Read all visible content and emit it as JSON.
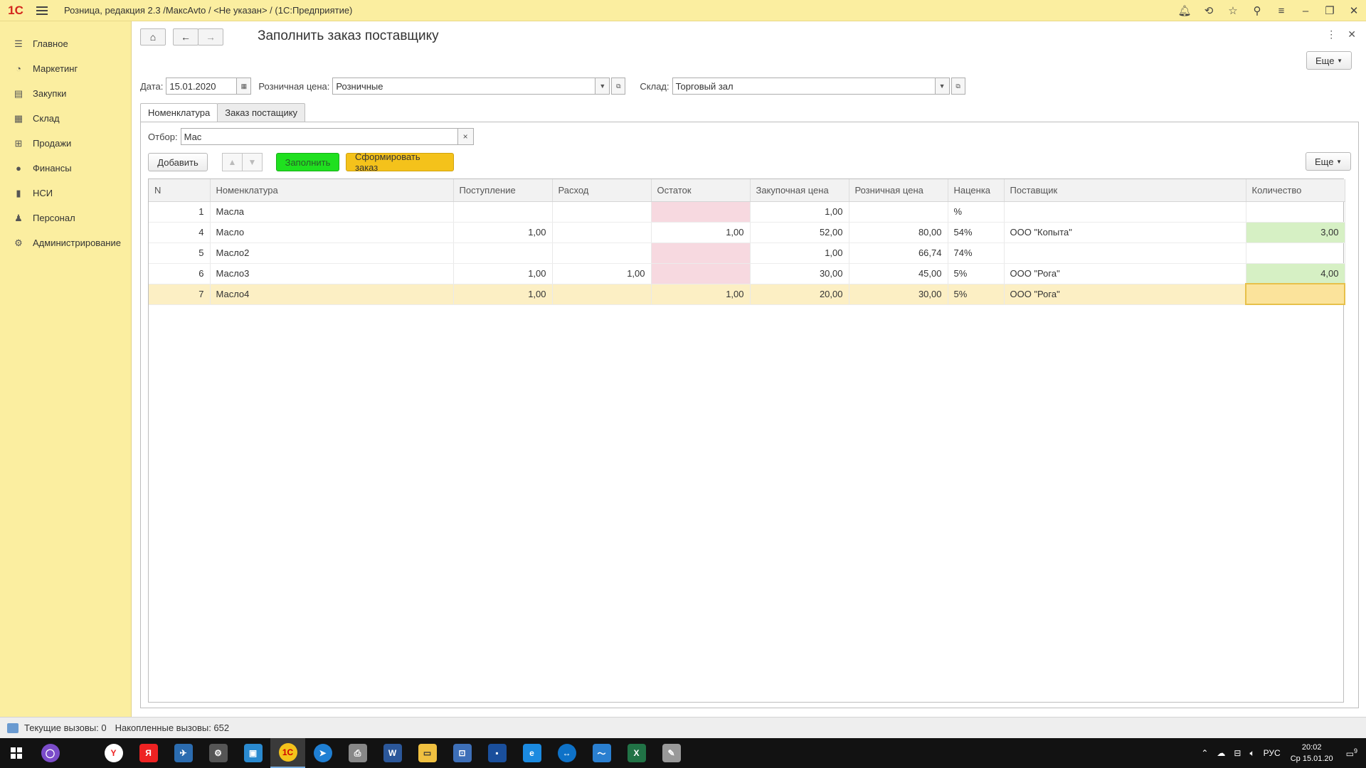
{
  "titlebar": {
    "logo": "1С",
    "title": "Розница, редакция 2.3 /МаксАvto / <Не указан> /  (1С:Предприятие)"
  },
  "sidebar": {
    "items": [
      {
        "label": "Главное",
        "icon": "menu-icon"
      },
      {
        "label": "Маркетинг",
        "icon": "pie-chart-icon"
      },
      {
        "label": "Закупки",
        "icon": "purchases-icon"
      },
      {
        "label": "Склад",
        "icon": "warehouse-icon"
      },
      {
        "label": "Продажи",
        "icon": "basket-icon"
      },
      {
        "label": "Финансы",
        "icon": "finance-icon"
      },
      {
        "label": "НСИ",
        "icon": "book-icon"
      },
      {
        "label": "Персонал",
        "icon": "person-icon"
      },
      {
        "label": "Администрирование",
        "icon": "gear-icon"
      }
    ]
  },
  "form": {
    "title": "Заполнить заказ поставщику",
    "more_label": "Еще",
    "date_label": "Дата:",
    "date_value": "15.01.2020",
    "price_label": "Розничная цена:",
    "price_value": "Розничные",
    "warehouse_label": "Склад:",
    "warehouse_value": "Торговый зал"
  },
  "tabs": [
    {
      "label": "Номенклатура",
      "active": true
    },
    {
      "label": "Заказ постащику",
      "active": false
    }
  ],
  "filter": {
    "label": "Отбор:",
    "value": "Мас",
    "clear": "×"
  },
  "toolbar": {
    "add_label": "Добавить",
    "fill_label": "Заполнить",
    "order_label": "Сформировать заказ",
    "more_label": "Еще",
    "colors": {
      "fill": "#1fe01f",
      "order": "#f4c21b"
    }
  },
  "table": {
    "columns": [
      "N",
      "Номенклатура",
      "Поступление",
      "Расход",
      "Остаток",
      "Закупочная цена",
      "Розничная цена",
      "Наценка",
      "Поставщик",
      "Количество"
    ],
    "rows": [
      {
        "n": "1",
        "name": "Масла",
        "in": "",
        "out": "",
        "rest": "",
        "buy": "1,00",
        "retail": "",
        "markup": "%",
        "supplier": "",
        "qty": ""
      },
      {
        "n": "4",
        "name": "Масло",
        "in": "1,00",
        "out": "",
        "rest": "1,00",
        "buy": "52,00",
        "retail": "80,00",
        "markup": "54%",
        "supplier": "ООО \"Копыта\"",
        "qty": "3,00"
      },
      {
        "n": "5",
        "name": "Масло2",
        "in": "",
        "out": "",
        "rest": "",
        "buy": "1,00",
        "retail": "66,74",
        "markup": "74%",
        "supplier": "",
        "qty": ""
      },
      {
        "n": "6",
        "name": "Масло3",
        "in": "1,00",
        "out": "1,00",
        "rest": "",
        "buy": "30,00",
        "retail": "45,00",
        "markup": "5%",
        "supplier": "ООО \"Рога\"",
        "qty": "4,00"
      },
      {
        "n": "7",
        "name": "Масло4",
        "in": "1,00",
        "out": "",
        "rest": "1,00",
        "buy": "20,00",
        "retail": "30,00",
        "markup": "5%",
        "supplier": "ООО \"Рога\"",
        "qty": ""
      }
    ]
  },
  "statusbar": {
    "current_calls": "Текущие вызовы: 0",
    "total_calls": "Накопленные вызовы: 652"
  },
  "taskbar": {
    "lang": "РУС",
    "time": "20:02",
    "date": "Ср 15.01.20",
    "notifications": "9"
  }
}
